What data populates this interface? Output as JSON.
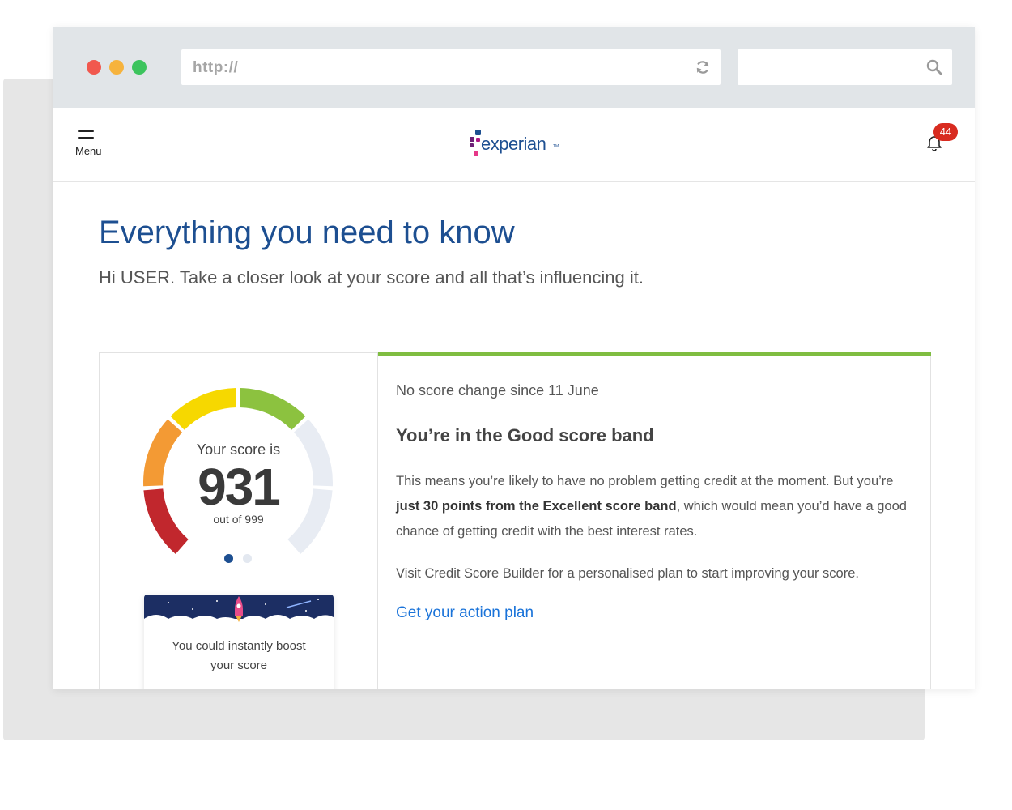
{
  "browser": {
    "url": "http://",
    "search_value": ""
  },
  "header": {
    "menu_label": "Menu",
    "logo_text": "experian",
    "logo_tm": "TM",
    "notification_count": "44"
  },
  "page": {
    "title": "Everything you need to know",
    "subtitle": "Hi USER. Take a closer look at your score and all that’s influencing it."
  },
  "score": {
    "label": "Your score is",
    "value": "931",
    "out_of": "out of 999",
    "max": 999,
    "band_colors": [
      "#c1272d",
      "#f39a34",
      "#f6d800",
      "#8cc23f"
    ],
    "track_color": "#e8ecf3"
  },
  "pager": {
    "total": 2,
    "active": 1
  },
  "boost": {
    "line1": "You could instantly boost",
    "line2": "your score"
  },
  "details": {
    "no_change": "No score change since 11 June",
    "band_heading": "You’re in the Good score band",
    "desc_part1": "This means you’re likely to have no problem getting credit at the moment. But you’re ",
    "desc_bold": "just 30 points from the Excellent score band",
    "desc_part2": ", which would mean you’d have a good chance of getting credit with the best interest rates.",
    "visit": "Visit Credit Score Builder for a personalised plan to start improving your score.",
    "action_link": "Get your action plan"
  },
  "colors": {
    "brand_blue": "#1d4f91",
    "accent_green": "#7fbd41",
    "link_blue": "#1a73d9",
    "badge_red": "#d82b20"
  }
}
